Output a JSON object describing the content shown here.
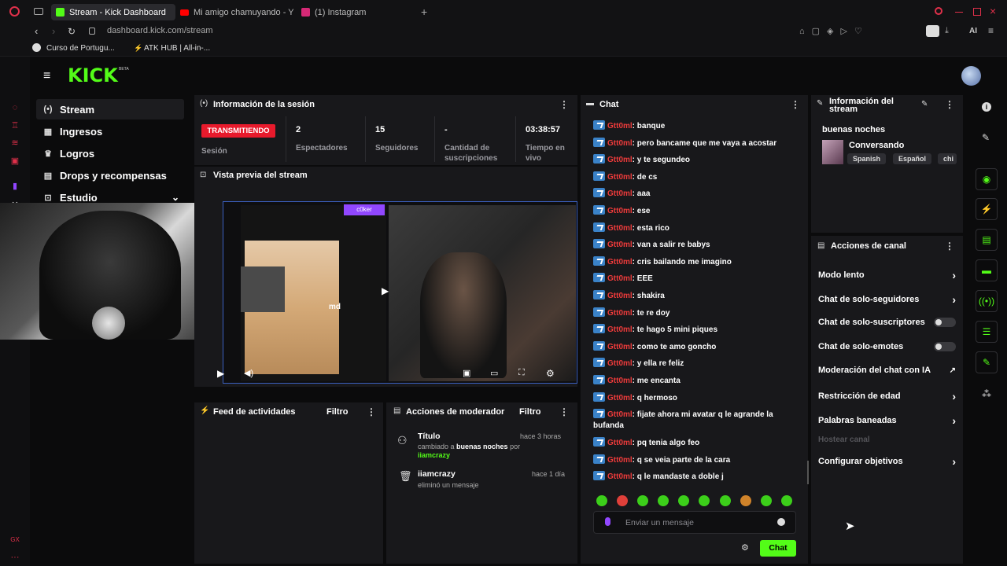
{
  "browser": {
    "tabs": [
      {
        "label": "Stream - Kick Dashboard",
        "active": true,
        "color": "#53fc18"
      },
      {
        "label": "Mi amigo chamuyando - Y",
        "active": false,
        "color": "#ff0000"
      },
      {
        "label": "(1) Instagram",
        "active": false,
        "color": "#d62976"
      }
    ],
    "new_tab": "+",
    "url": "dashboard.kick.com/stream",
    "ai_label": "AI",
    "bookmarks": [
      {
        "label": "Curso de Portugu..."
      },
      {
        "label": "ATK HUB | All-in-..."
      }
    ]
  },
  "kick": {
    "brand_color": "#53fc18",
    "logo": "KICK",
    "beta": "BETA",
    "nav": [
      {
        "label": "Stream",
        "icon": "broadcast-icon",
        "active": true
      },
      {
        "label": "Ingresos",
        "icon": "chart-icon"
      },
      {
        "label": "Logros",
        "icon": "trophy-icon"
      },
      {
        "label": "Drops y recompensas",
        "icon": "gift-icon"
      },
      {
        "label": "Estudio",
        "icon": "studio-icon"
      }
    ]
  },
  "session": {
    "title": "Información de la sesión",
    "status": "TRANSMITIENDO",
    "status_label": "Sesión",
    "viewers": "2",
    "viewers_label": "Espectadores",
    "followers": "15",
    "followers_label": "Seguidores",
    "subs": "-",
    "subs_label": "Cantidad de suscripciones",
    "time": "03:38:57",
    "time_label": "Tiempo en vivo"
  },
  "preview": {
    "title": "Vista previa del stream",
    "overlay_user": "c0ker",
    "caption_text": "md"
  },
  "feed": {
    "title": "Feed de actividades",
    "filter": "Filtro"
  },
  "mod": {
    "title": "Acciones de moderador",
    "filter": "Filtro",
    "items": [
      {
        "title": "Título",
        "time": "hace 3 horas",
        "pre": "cambiado a",
        "value": "buenas noches",
        "by": "por",
        "user": "iiamcrazy"
      },
      {
        "title": "iiamcrazy",
        "time": "hace 1 día",
        "desc": "eliminó un mensaje"
      }
    ]
  },
  "chat": {
    "title": "Chat",
    "messages": [
      {
        "user": "Gtt0ml",
        "text": ": banque"
      },
      {
        "user": "Gtt0ml",
        "text": ": pero bancame que me vaya a acostar"
      },
      {
        "user": "Gtt0ml",
        "text": ": y te segundeo"
      },
      {
        "user": "Gtt0ml",
        "text": ": de cs"
      },
      {
        "user": "Gtt0ml",
        "text": ": aaa"
      },
      {
        "user": "Gtt0ml",
        "text": ": ese"
      },
      {
        "user": "Gtt0ml",
        "text": ": esta rico"
      },
      {
        "user": "Gtt0ml",
        "text": ": van a salir re babys"
      },
      {
        "user": "Gtt0ml",
        "text": ": cris bailando me imagino"
      },
      {
        "user": "Gtt0ml",
        "text": ": EEE"
      },
      {
        "user": "Gtt0ml",
        "text": ": shakira"
      },
      {
        "user": "Gtt0ml",
        "text": ": te re doy"
      },
      {
        "user": "Gtt0ml",
        "text": ": te hago 5 mini piques"
      },
      {
        "user": "Gtt0ml",
        "text": ": como te amo goncho"
      },
      {
        "user": "Gtt0ml",
        "text": ": y ella re feliz"
      },
      {
        "user": "Gtt0ml",
        "text": ": me encanta"
      },
      {
        "user": "Gtt0ml",
        "text": ": q hermoso"
      },
      {
        "user": "Gtt0ml",
        "text": ": fijate ahora mi avatar q le agrande la bufanda"
      },
      {
        "user": "Gtt0ml",
        "text": ": pq tenia algo feo"
      },
      {
        "user": "Gtt0ml",
        "text": ": q se veia parte de la cara"
      },
      {
        "user": "Gtt0ml",
        "text": ": q le mandaste a doble j"
      }
    ],
    "placeholder": "Enviar un mensaje",
    "send": "Chat"
  },
  "stream_info": {
    "title": "Información del stream",
    "stream_title": "buenas noches",
    "category": "Conversando",
    "tags": [
      "Spanish",
      "Español",
      "chi"
    ]
  },
  "channel_actions": {
    "title": "Acciones de canal",
    "items": [
      {
        "label": "Modo lento",
        "control": "chevron"
      },
      {
        "label": "Chat de solo-seguidores",
        "control": "chevron"
      },
      {
        "label": "Chat de solo-suscriptores",
        "control": "toggle"
      },
      {
        "label": "Chat de solo-emotes",
        "control": "toggle"
      },
      {
        "label": "Moderación del chat con IA",
        "control": "external"
      },
      {
        "label": "Restricción de edad",
        "control": "chevron"
      },
      {
        "label": "Palabras baneadas",
        "control": "chevron"
      },
      {
        "label": "Hostear canal",
        "control": "disabled"
      },
      {
        "label": "Configurar objetivos",
        "control": "chevron"
      }
    ]
  },
  "right_sidebar": [
    "info-icon",
    "pencil-icon",
    "record-icon",
    "lightning-icon",
    "document-icon",
    "chat-bubble-icon",
    "broadcast-icon",
    "layers-icon",
    "wrench-icon",
    "dots-cluster-icon"
  ]
}
